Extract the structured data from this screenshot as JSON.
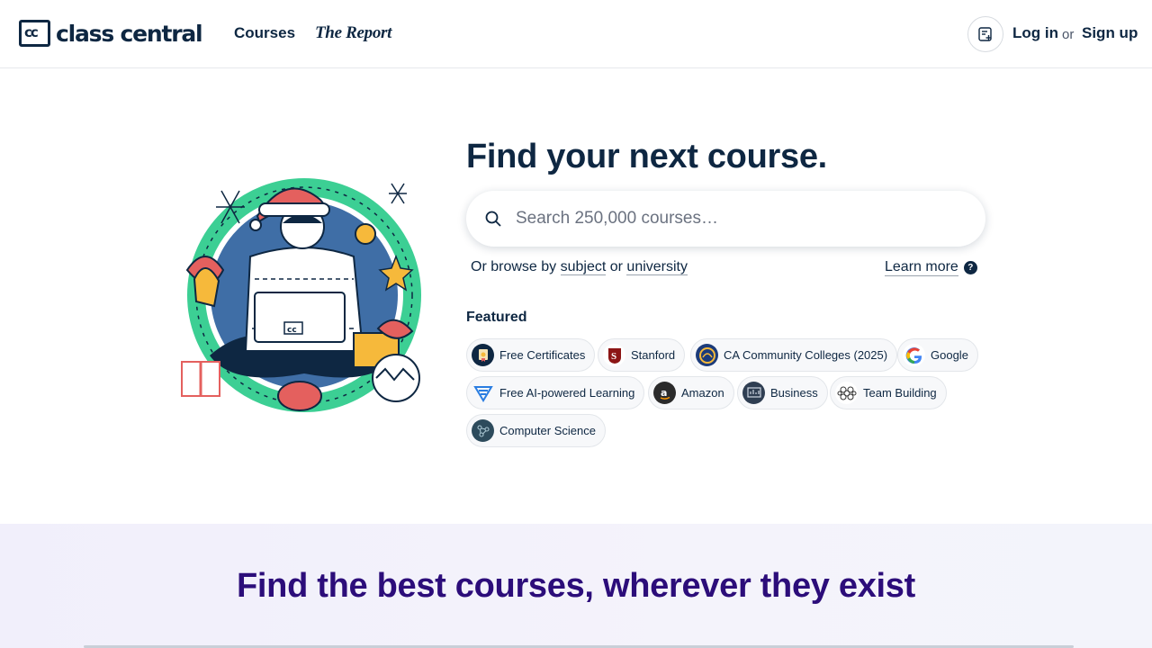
{
  "header": {
    "logo_text": "class central",
    "logo_mark": "cc",
    "nav": {
      "courses": "Courses",
      "report": "The Report"
    },
    "list_icon": "list-add-icon",
    "login": "Log in",
    "or": "or",
    "signup": "Sign up"
  },
  "hero": {
    "title": "Find your next course.",
    "search": {
      "placeholder": "Search 250,000 courses…",
      "icon": "search-icon"
    },
    "browse_prefix": "Or browse by ",
    "browse_subject": "subject",
    "browse_or": " or ",
    "browse_university": "university",
    "learn_more": "Learn more",
    "help_icon": "?",
    "illustration_badge": "cc"
  },
  "featured": {
    "label": "Featured",
    "chips": [
      {
        "label": "Free Certificates",
        "icon": "certificate-icon"
      },
      {
        "label": "Stanford",
        "icon": "stanford-logo-icon"
      },
      {
        "label": "CA Community Colleges (2025)",
        "icon": "ca-colleges-logo-icon"
      },
      {
        "label": "Google",
        "icon": "google-logo-icon"
      },
      {
        "label": "Free AI-powered Learning",
        "icon": "ai-learning-icon"
      },
      {
        "label": "Amazon",
        "icon": "amazon-logo-icon"
      },
      {
        "label": "Business",
        "icon": "business-icon"
      },
      {
        "label": "Team Building",
        "icon": "team-building-icon"
      },
      {
        "label": "Computer Science",
        "icon": "computer-science-icon"
      }
    ]
  },
  "band": {
    "title": "Find the best courses, wherever they exist"
  },
  "colors": {
    "navy": "#0e2742",
    "band_title": "#2c0d7a",
    "band_bg": "#f1effb",
    "chip_bg": "#f7f8fa"
  }
}
